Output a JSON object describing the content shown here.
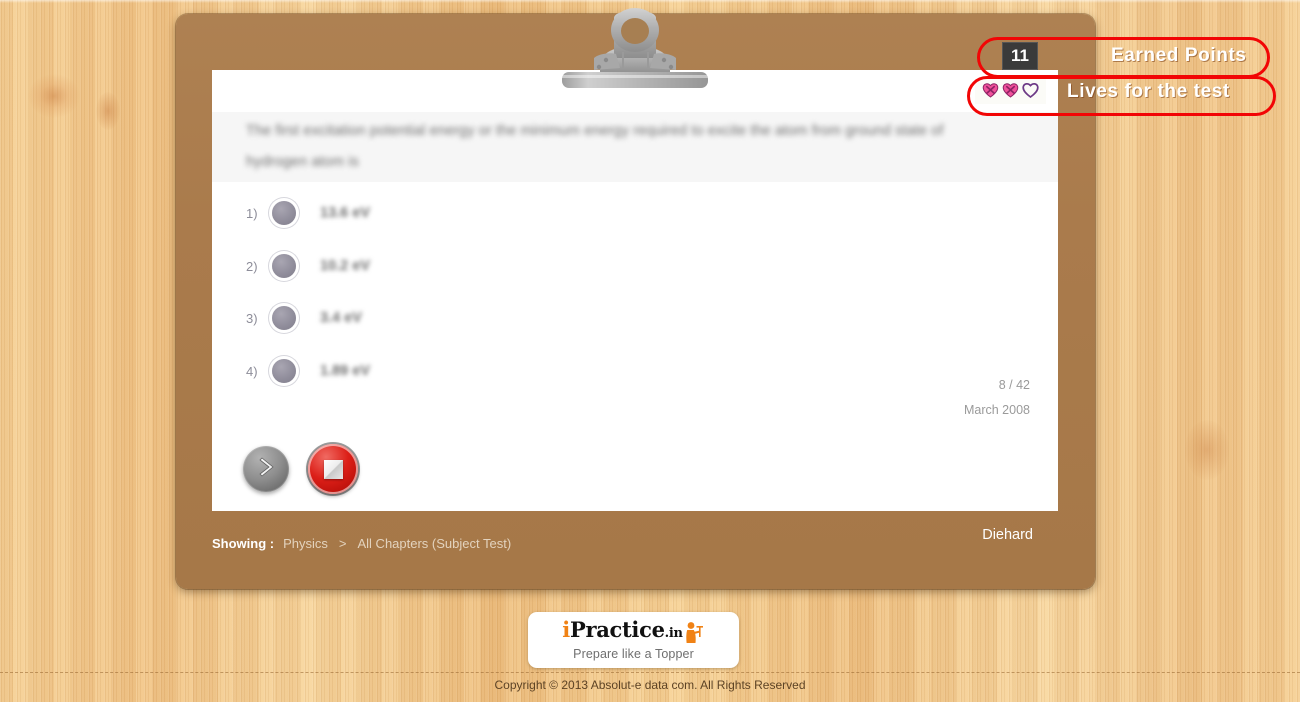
{
  "badges": {
    "points_value": "11",
    "points_label": "Earned Points",
    "lives_label": "Lives for the test",
    "lives_remaining": 2,
    "lives_total": 3,
    "annotation_color": "#f20505",
    "points_box_bg": "#3a3a3a"
  },
  "question": {
    "text": "The first excitation potential energy or the minimum energy required to excite the atom from ground state of hydrogen atom is",
    "counter": "8 / 42",
    "date": "March 2008",
    "options": [
      {
        "num": "1)",
        "label": "13.6 eV"
      },
      {
        "num": "2)",
        "label": "10.2 eV"
      },
      {
        "num": "3)",
        "label": "3.4 eV"
      },
      {
        "num": "4)",
        "label": "1.89 eV"
      }
    ]
  },
  "controls": {
    "next_name": "next-question-button",
    "stop_name": "stop-test-button"
  },
  "showing": {
    "label": "Showing :",
    "subject": "Physics",
    "separator": ">",
    "scope": "All Chapters (Subject Test)",
    "rank": "Diehard"
  },
  "logo": {
    "mark_i": "i",
    "mark_practice": "Practice",
    "mark_tld": ".in",
    "tagline": "Prepare like a Topper",
    "accent_color": "#f08215"
  },
  "footer": {
    "copyright": "Copyright © 2013 Absolut-e data com. All Rights Reserved"
  },
  "theme": {
    "clipboard_brown": "#aa7b4c",
    "page_white": "#ffffff",
    "question_band": "#f6f6f6",
    "wood_light": "#f5ce93"
  }
}
